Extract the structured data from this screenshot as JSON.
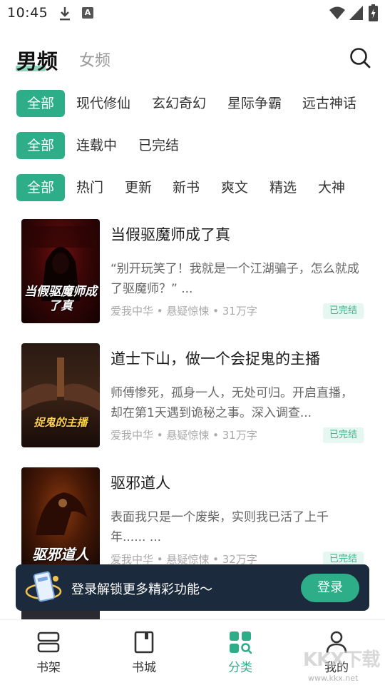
{
  "status_bar": {
    "time": "10:45",
    "a_badge": "A"
  },
  "header": {
    "tab_male": "男频",
    "tab_female": "女频"
  },
  "filters": {
    "genres": [
      "全部",
      "现代修仙",
      "玄幻奇幻",
      "星际争霸",
      "远古神话"
    ],
    "progress": [
      "全部",
      "连载中",
      "已完结"
    ],
    "sort": [
      "全部",
      "热门",
      "更新",
      "新书",
      "爽文",
      "精选",
      "大神"
    ]
  },
  "books": [
    {
      "title": "当假驱魔师成了真",
      "desc": "“别开玩笑了！我就是一个江湖骗子，怎么就成了驱魔师？” ...",
      "meta": "爱我中华 • 悬疑惊悚 • 31万字",
      "status": "已完结",
      "cover_text": "当假驱魔师成了真"
    },
    {
      "title": "道士下山，做一个会捉鬼的主播",
      "desc": "师傅惨死，孤身一人，无处可归。开启直播，却在第1天遇到诡秘之事。深入调查...",
      "meta": "爱我中华 • 悬疑惊悚 • 31万字",
      "status": "已完结",
      "cover_text": "捉鬼的主播"
    },
    {
      "title": "驱邪道人",
      "desc": "表面我只是一个废柴，实则我已活了上千年...... ...",
      "meta": "爱我中华 • 悬疑惊悚 • 32万字",
      "status": "已完结",
      "cover_text": "驱邪道人"
    }
  ],
  "login_banner": {
    "text": "登录解锁更多精彩功能～",
    "button": "登录"
  },
  "bottom_nav": [
    {
      "label": "书架",
      "icon": "bookshelf-icon"
    },
    {
      "label": "书城",
      "icon": "bookstore-icon"
    },
    {
      "label": "分类",
      "icon": "category-icon"
    },
    {
      "label": "我的",
      "icon": "profile-icon"
    }
  ],
  "watermark": {
    "brand": "KKX下载",
    "url": "www.kkx.net"
  },
  "colors": {
    "accent": "#2eae88",
    "banner_bg": "#1c2a3e"
  }
}
